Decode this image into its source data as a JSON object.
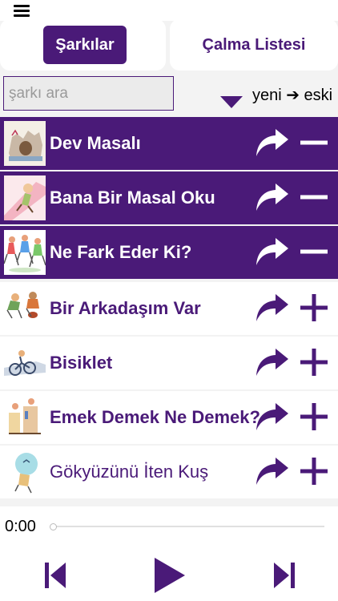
{
  "tabs": {
    "songs": "Şarkılar",
    "playlist": "Çalma Listesi"
  },
  "search": {
    "placeholder": "şarkı ara"
  },
  "sort": {
    "label": "yeni ➔ eski"
  },
  "songs": [
    {
      "title": "Dev Masalı",
      "state": "in-playlist",
      "action_icon": "minus-icon"
    },
    {
      "title": "Bana Bir Masal Oku",
      "state": "in-playlist",
      "action_icon": "minus-icon"
    },
    {
      "title": "Ne Fark Eder Ki?",
      "state": "in-playlist",
      "action_icon": "minus-icon"
    },
    {
      "title": "Bir Arkadaşım Var",
      "state": "not-in-playlist",
      "action_icon": "plus-icon"
    },
    {
      "title": "Bisiklet",
      "state": "not-in-playlist",
      "action_icon": "plus-icon"
    },
    {
      "title": "Emek Demek Ne Demek?",
      "state": "not-in-playlist",
      "action_icon": "plus-icon"
    },
    {
      "title": "Gökyüzünü İten Kuş",
      "state": "not-in-playlist",
      "action_icon": "plus-icon"
    }
  ],
  "player": {
    "time": "0:00",
    "progress": 0
  },
  "colors": {
    "accent": "#4a1a78",
    "background": "#f3f3f3",
    "row": "#ffffff"
  }
}
